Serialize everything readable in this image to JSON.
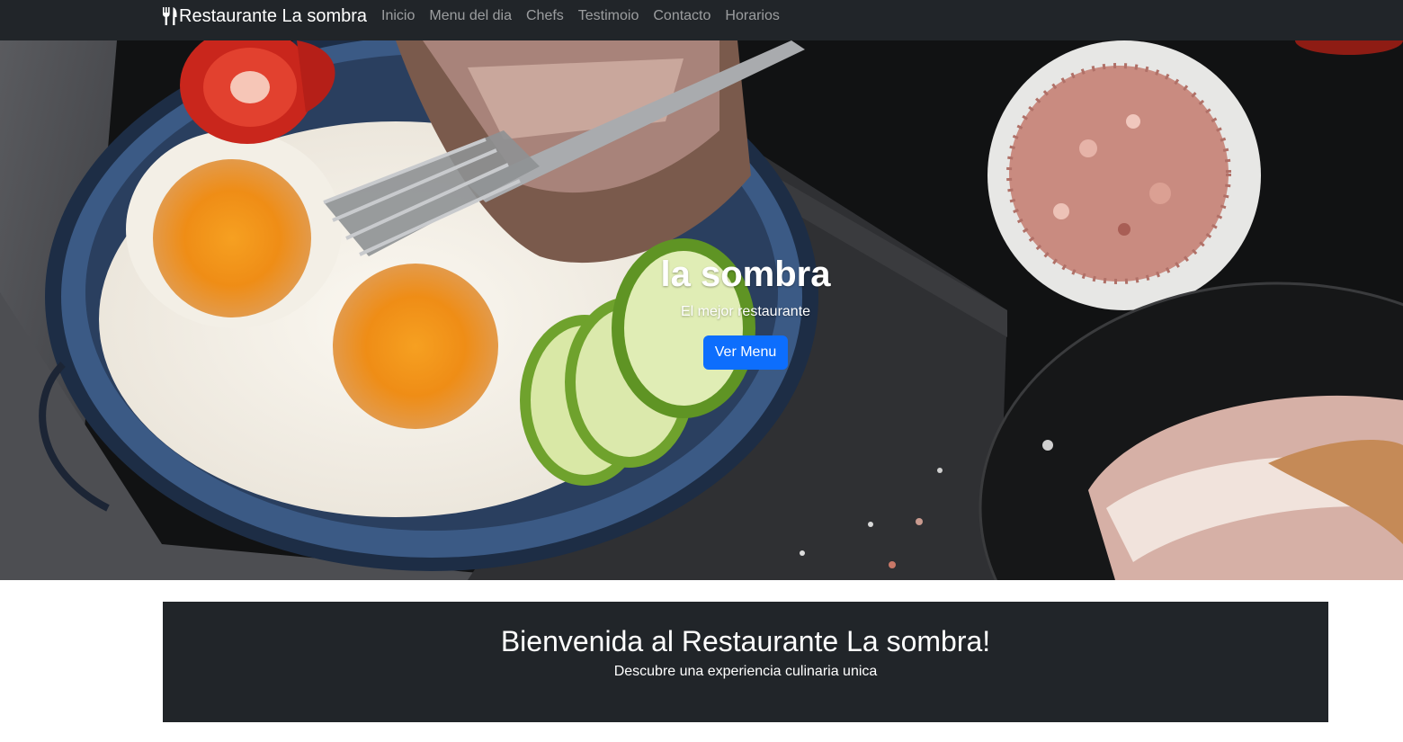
{
  "navbar": {
    "brand_icon": "fork-knife-icon",
    "brand": "Restaurante La sombra",
    "links": [
      "Inicio",
      "Menu del dia",
      "Chefs",
      "Testimoio",
      "Contacto",
      "Horarios"
    ]
  },
  "hero": {
    "title": "la sombra",
    "subtitle": "El mejor restaurante",
    "button": "Ver Menu",
    "button_color": "#0d6efd"
  },
  "welcome": {
    "title": "Bienvenida al Restaurante La sombra!",
    "subtitle": "Descubre una experiencia culinaria unica"
  },
  "colors": {
    "navbar_bg": "#212529",
    "welcome_bg": "#212529",
    "nav_link": "#8c8f92"
  }
}
